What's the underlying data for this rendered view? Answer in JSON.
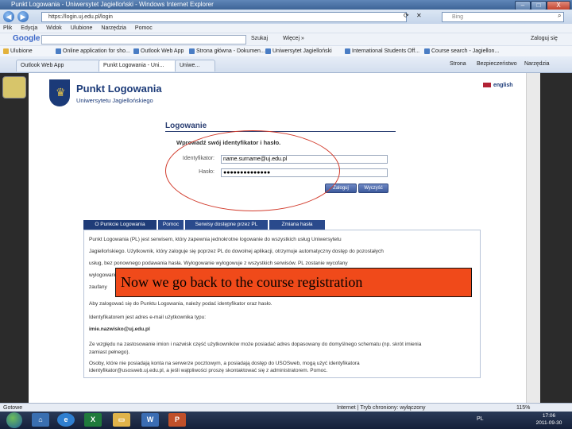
{
  "window": {
    "title": "Punkt Logowania - Uniwersytet Jagielloński - Windows Internet Explorer",
    "min": "–",
    "max": "□",
    "close": "X"
  },
  "address": {
    "url": "https://login.uj.edu.pl/login",
    "search_provider": "Bing"
  },
  "menu": [
    "Plik",
    "Edycja",
    "Widok",
    "Ulubione",
    "Narzędzia",
    "Pomoc"
  ],
  "google_bar": {
    "logo": "Google",
    "search_label": "Szukaj",
    "more_label": "Więcej »",
    "login_label": "Zaloguj się"
  },
  "favorites": {
    "label": "Ulubione",
    "items": [
      "Online application for sho...",
      "Outlook Web App",
      "Strona główna - Dokumen...",
      "Uniwersytet Jagielloński",
      "International Students Off...",
      "Course search - Jagiellon..."
    ],
    "right": [
      "Strona",
      "Bezpieczeństwo",
      "Narzędzia"
    ]
  },
  "tabs": [
    "Outlook Web App",
    "Punkt Logowania - Uni...",
    "Uniwe..."
  ],
  "brand": {
    "title": "Punkt Logowania",
    "subtitle": "Uniwersytetu Jagiellońskiego",
    "language_link": "english"
  },
  "login": {
    "heading": "Logowanie",
    "prompt": "Wprowadź swój identyfikator i hasło.",
    "id_label": "Identyfikator:",
    "id_value": "name.surname@uj.edu.pl",
    "password_label": "Hasło:",
    "password_value": "●●●●●●●●●●●●●●",
    "submit": "Zaloguj",
    "clear": "Wyczyść"
  },
  "info_tabs": [
    "O Punkcie Logowania",
    "Pomoc",
    "Serwisy dostępne przez PL",
    "Zmiana hasła"
  ],
  "info_text": [
    "Punkt Logowania (PL) jest serwisem, który zapewnia jednokrotne logowanie do wszystkich usług Uniwersytetu",
    "Jagiellońskiego. Użytkownik, który zaloguje się poprzez PL do dowolnej aplikacji, otrzymuje automatyczny dostęp do pozostałych",
    "usług, bez ponownego podawania hasła. Wylogowanie wylogowuje z wszystkich serwisów. PL zostanie wycofany",
    "wylogowaniu",
    "zaufany",
    "Aby zalogować się do Punktu Logowania, należy podać identyfikator oraz hasło.",
    "Identyfikatorem jest adres e-mail użytkownika typu:",
    "imie.nazwisko@uj.edu.pl",
    "Ze względu na zastosowanie imion i nazwisk część użytkowników może posiadać adres dopasowany do domyślnego schematu (np. skrót imienia",
    "zamiast pełnego).",
    "Osoby, które nie posiadają konta na serwerze pocztowym, a posiadają dostęp do USOSweb, mogą użyć identyfikatora",
    "identyfikator@usosweb.uj.edu.pl, a jeśli wątpliwości proszę skontaktować się z administratorem. Pomoc."
  ],
  "overlay": "Now we go back to the course registration",
  "status": {
    "left": "Gotowe",
    "zone": "Internet | Tryb chroniony: wyłączony",
    "zoom": "115%"
  },
  "taskbar": {
    "lang": "PL",
    "time": "17:06",
    "date": "2011-09-30"
  }
}
